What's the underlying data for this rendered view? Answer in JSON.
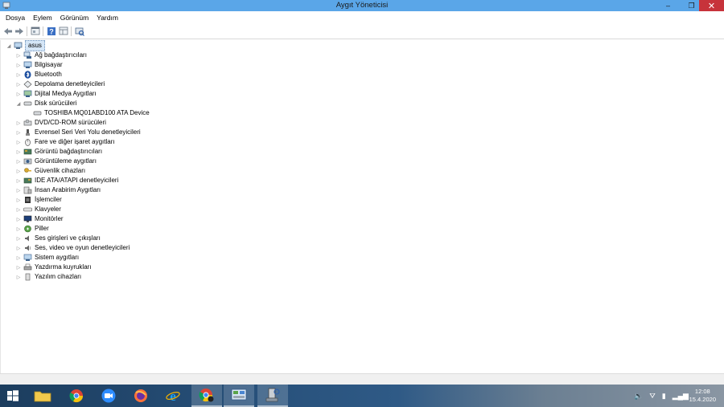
{
  "window": {
    "title": "Aygıt Yöneticisi",
    "minimize_glyph": "–",
    "restore_glyph": "❐",
    "close_glyph": "✕"
  },
  "menu": [
    "Dosya",
    "Eylem",
    "Görünüm",
    "Yardım"
  ],
  "toolbar": {
    "icons": [
      "back-arrow-icon",
      "forward-arrow-icon",
      "properties-icon",
      "help-icon",
      "view-icon",
      "scan-hardware-icon"
    ]
  },
  "tree": {
    "root": "asus",
    "items": [
      {
        "label": "Ağ bağdaştırıcıları",
        "icon": "network-adapter-icon",
        "expanded": false
      },
      {
        "label": "Bilgisayar",
        "icon": "computer-icon",
        "expanded": false
      },
      {
        "label": "Bluetooth",
        "icon": "bluetooth-icon",
        "expanded": false
      },
      {
        "label": "Depolama denetleyicileri",
        "icon": "storage-controller-icon",
        "expanded": false
      },
      {
        "label": "Dijital Medya Aygıtları",
        "icon": "digital-media-icon",
        "expanded": false
      },
      {
        "label": "Disk sürücüleri",
        "icon": "disk-drive-icon",
        "expanded": true,
        "children": [
          "TOSHIBA MQ01ABD100 ATA Device"
        ]
      },
      {
        "label": "DVD/CD-ROM sürücüleri",
        "icon": "dvd-drive-icon",
        "expanded": false
      },
      {
        "label": "Evrensel Seri Veri Yolu denetleyicileri",
        "icon": "usb-icon",
        "expanded": false
      },
      {
        "label": "Fare ve diğer işaret aygıtları",
        "icon": "mouse-icon",
        "expanded": false
      },
      {
        "label": "Görüntü bağdaştırıcıları",
        "icon": "display-adapter-icon",
        "expanded": false
      },
      {
        "label": "Görüntüleme aygıtları",
        "icon": "imaging-device-icon",
        "expanded": false
      },
      {
        "label": "Güvenlik cihazları",
        "icon": "security-device-icon",
        "expanded": false
      },
      {
        "label": "IDE ATA/ATAPI denetleyicileri",
        "icon": "ide-controller-icon",
        "expanded": false
      },
      {
        "label": "İnsan Arabirim Aygıtları",
        "icon": "hid-icon",
        "expanded": false
      },
      {
        "label": "İşlemciler",
        "icon": "processor-icon",
        "expanded": false
      },
      {
        "label": "Klavyeler",
        "icon": "keyboard-icon",
        "expanded": false
      },
      {
        "label": "Monitörler",
        "icon": "monitor-icon",
        "expanded": false
      },
      {
        "label": "Piller",
        "icon": "battery-icon",
        "expanded": false
      },
      {
        "label": "Ses girişleri ve çıkışları",
        "icon": "audio-io-icon",
        "expanded": false
      },
      {
        "label": "Ses, video ve oyun denetleyicileri",
        "icon": "sound-video-icon",
        "expanded": false
      },
      {
        "label": "Sistem aygıtları",
        "icon": "system-device-icon",
        "expanded": false
      },
      {
        "label": "Yazdırma kuyrukları",
        "icon": "print-queue-icon",
        "expanded": false
      },
      {
        "label": "Yazılım cihazları",
        "icon": "software-device-icon",
        "expanded": false
      }
    ]
  },
  "taskbar": {
    "apps": [
      {
        "name": "start-button",
        "active": false
      },
      {
        "name": "file-explorer-app",
        "active": false
      },
      {
        "name": "chrome-app",
        "active": false
      },
      {
        "name": "zoom-app",
        "active": false
      },
      {
        "name": "firefox-app",
        "active": false
      },
      {
        "name": "internet-explorer-app",
        "active": false
      },
      {
        "name": "chrome-profile-app",
        "active": true
      },
      {
        "name": "control-panel-app",
        "active": true
      },
      {
        "name": "device-manager-app",
        "active": true
      }
    ],
    "time": "12:08",
    "date": "15.4.2020"
  },
  "colors": {
    "titlebar": "#5aa6e8",
    "close": "#c7333b",
    "selection": "#d5e6f7"
  }
}
